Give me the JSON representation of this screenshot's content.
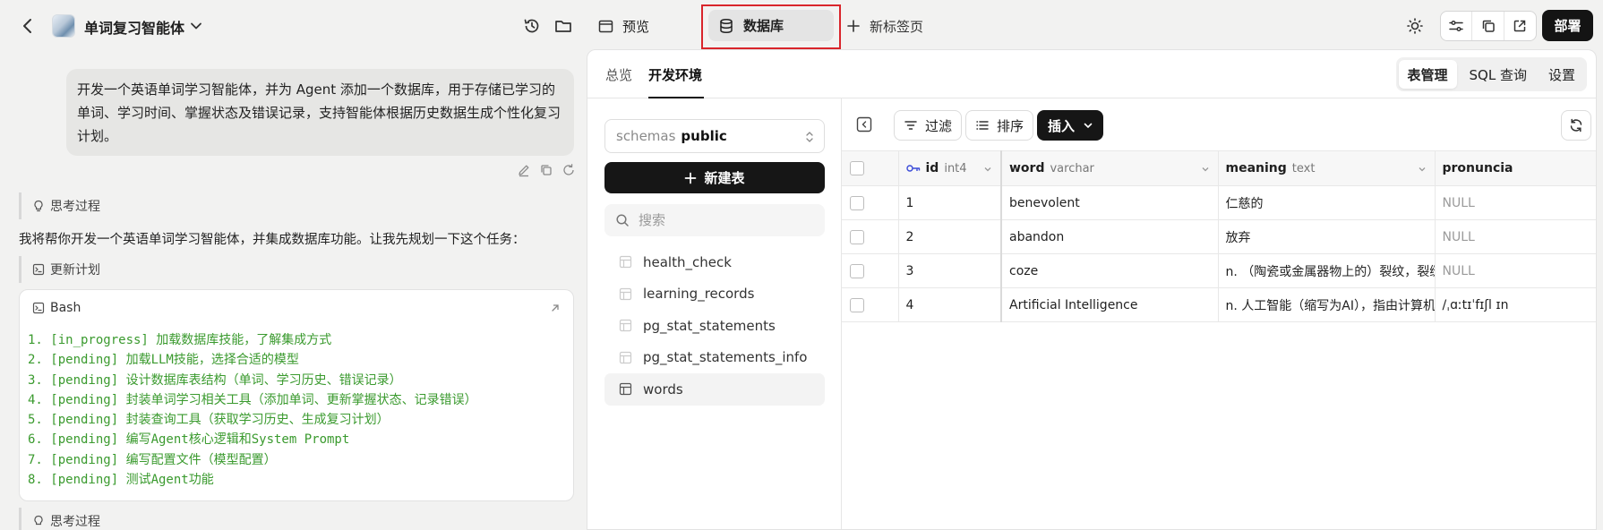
{
  "header": {
    "agent_title": "单词复习智能体",
    "tabs": [
      {
        "label": "预览",
        "icon": "preview-icon"
      },
      {
        "label": "数据库",
        "icon": "database-icon",
        "active": true
      },
      {
        "label": "新标签页",
        "icon": "plus-icon"
      }
    ],
    "deploy_label": "部署"
  },
  "chat": {
    "user_message": "开发一个英语单词学习智能体，并为 Agent 添加一个数据库，用于存储已学习的单词、学习时间、掌握状态及错误记录，支持智能体根据历史数据生成个性化复习计划。",
    "thought_label": "思考过程",
    "assistant_text": "我将帮你开发一个英语单词学习智能体，并集成数据库功能。让我先规划一下这个任务：",
    "plan_label": "更新计划",
    "bash_title": "Bash",
    "bash_lines": [
      "1. [in_progress] 加载数据库技能，了解集成方式",
      "2. [pending] 加载LLM技能，选择合适的模型",
      "3. [pending] 设计数据库表结构（单词、学习历史、错误记录）",
      "4. [pending] 封装单词学习相关工具（添加单词、更新掌握状态、记录错误）",
      "5. [pending] 封装查询工具（获取学习历史、生成复习计划）",
      "6. [pending] 编写Agent核心逻辑和System Prompt",
      "7. [pending] 编写配置文件（模型配置）",
      "8. [pending] 测试Agent功能"
    ],
    "thought_label_2": "思考过程"
  },
  "db": {
    "tabs": {
      "overview": "总览",
      "dev": "开发环境"
    },
    "subtabs": [
      "表管理",
      "SQL 查询",
      "设置"
    ],
    "schema_prefix": "schemas",
    "schema_value": "public",
    "new_table_label": "新建表",
    "search_placeholder": "搜索",
    "tables": [
      "health_check",
      "learning_records",
      "pg_stat_statements",
      "pg_stat_statements_info",
      "words"
    ],
    "active_table": "words",
    "toolbar": {
      "filter": "过滤",
      "sort": "排序",
      "insert": "插入"
    },
    "columns": [
      {
        "name": "id",
        "type": "int4"
      },
      {
        "name": "word",
        "type": "varchar"
      },
      {
        "name": "meaning",
        "type": "text"
      },
      {
        "name": "pronuncia",
        "type": ""
      }
    ],
    "rows": [
      {
        "id": "1",
        "word": "benevolent",
        "meaning": "仁慈的",
        "pronunciation": "NULL"
      },
      {
        "id": "2",
        "word": "abandon",
        "meaning": "放弃",
        "pronunciation": "NULL"
      },
      {
        "id": "3",
        "word": "coze",
        "meaning": "n. （陶瓷或金属器物上的）裂纹，裂缝；（",
        "pronunciation": "NULL"
      },
      {
        "id": "4",
        "word": "Artificial Intelligence",
        "meaning": "n. 人工智能（缩写为AI），指由计算机系统",
        "pronunciation": "/ˌɑːtɪˈfɪʃl ɪn"
      }
    ]
  },
  "colors": {
    "highlight": "#d9252b",
    "accent_dark": "#161616",
    "code_green": "#3a9a2e"
  }
}
